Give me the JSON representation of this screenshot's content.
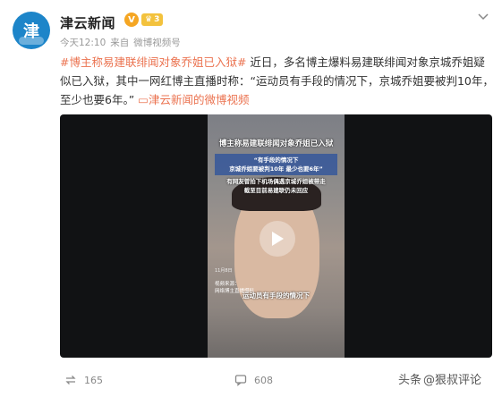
{
  "post": {
    "author": "津云新闻",
    "avatar_text": "津",
    "verified_mark": "V",
    "level": "3",
    "time": "今天12:10",
    "source_prefix": "来自",
    "source_app": "微博视频号"
  },
  "content": {
    "hashtag": "#博主称易建联绯闻对象乔姐已入狱#",
    "body": " 近日，多名博主爆料易建联绯闻对象京城乔姐疑似已入狱，其中一网红博主直播时称：“运动员有手段的情况下，京城乔姐要被判10年，至少也要6年。”",
    "video_link": "津云新闻的微博视频"
  },
  "video": {
    "title": "博主称易建联绯闻对象乔姐已入狱",
    "quote_line1": "“有手段的情况下",
    "quote_line2": "京城乔姐要被判10年 最少也要6年”",
    "news_line1": "有网友曾拍下机场偶遇京城乔姐被带走",
    "news_line2": "截至目前易建联仍未回应",
    "stamp": "11月8日",
    "source_line1": "视频来源：",
    "source_line2": "网络博主直播爆料",
    "caption": "运动员有手段的情况下"
  },
  "actions": {
    "repost_count": "165",
    "comment_count": "608"
  },
  "watermark": {
    "prefix": "头条",
    "handle": "@狠叔评论"
  },
  "colors": {
    "link": "#eb7350",
    "avatar_bg": "#1d85c9",
    "verified": "#f5a623"
  }
}
